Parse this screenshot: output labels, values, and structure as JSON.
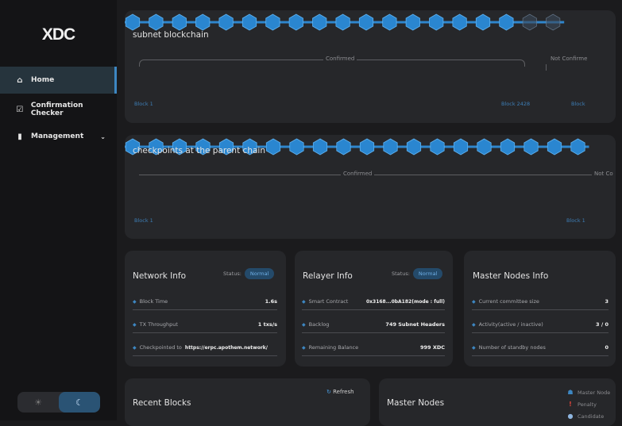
{
  "brand": {
    "logo": "XDC"
  },
  "sidebar": {
    "items": [
      {
        "label": "Home",
        "icon": "home-icon"
      },
      {
        "label": "Confirmation Checker",
        "icon": "checklist-icon"
      },
      {
        "label": "Management",
        "icon": "bar-chart-icon"
      }
    ]
  },
  "subnet": {
    "title": "subnet blockchain",
    "confirmed_label": "Confirmed",
    "not_confirmed_label": "Not Confirme",
    "first_block": "Block 1",
    "last_confirmed_block": "Block 2428",
    "last_block": "Block"
  },
  "parent": {
    "title": "checkpoints at the parent chain",
    "confirmed_label": "Confirmed",
    "not_confirmed_label": "Not Co",
    "first_block": "Block 1",
    "last_block": "Block 1"
  },
  "network": {
    "title": "Network Info",
    "status_label": "Status:",
    "status_value": "Normal",
    "rows": [
      {
        "label": "Block Time",
        "value": "1.6s"
      },
      {
        "label": "TX Throughput",
        "value": "1 txs/s"
      },
      {
        "label": "Checkpointed to",
        "value": "https://erpc.apothem.network/"
      }
    ]
  },
  "relayer": {
    "title": "Relayer Info",
    "status_label": "Status:",
    "status_value": "Normal",
    "rows": [
      {
        "label": "Smart Contract",
        "value": "0x3168...0bA182(mode : full)"
      },
      {
        "label": "Backlog",
        "value": "749 Subnet Headers"
      },
      {
        "label": "Remaining Balance",
        "value": "999 XDC"
      }
    ]
  },
  "masternodes_info": {
    "title": "Master Nodes Info",
    "rows": [
      {
        "label": "Current committee size",
        "value": "3"
      },
      {
        "label": "Activity(active / inactive)",
        "value": "3 / 0"
      },
      {
        "label": "Number of standby nodes",
        "value": "0"
      }
    ]
  },
  "recent_blocks": {
    "title": "Recent Blocks",
    "refresh_label": "Refresh"
  },
  "master_nodes": {
    "title": "Master Nodes",
    "legend": [
      {
        "label": "Master Node",
        "icon": "master-node-icon"
      },
      {
        "label": "Penalty",
        "icon": "penalty-icon"
      },
      {
        "label": "Candidate",
        "icon": "candidate-icon"
      }
    ]
  },
  "theme": {
    "light_icon": "sun-icon",
    "dark_icon": "moon-icon"
  }
}
